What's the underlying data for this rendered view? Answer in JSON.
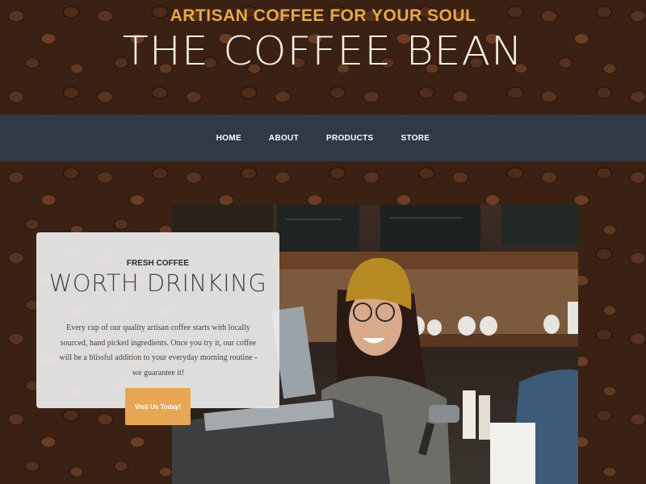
{
  "header": {
    "tagline": "ARTISAN COFFEE FOR YOUR SOUL",
    "title": "THE COFFEE BEAN"
  },
  "nav": {
    "items": [
      "HOME",
      "ABOUT",
      "PRODUCTS",
      "STORE"
    ]
  },
  "intro": {
    "kicker": "FRESH COFFEE",
    "heading": "WORTH DRINKING",
    "text": "Every cup of our quality artisan coffee starts with locally sourced, hand picked ingredients. Once you try it, our coffee will be a blissful addition to your everyday morning routine - we guarantee it!",
    "button_label": "Visit Us Today!"
  },
  "colors": {
    "accent": "#e6a653",
    "nav_bg": "#303946",
    "tagline": "#e8a84a"
  },
  "images": {
    "background": "coffee-beans",
    "photo": "barista-smiling-at-espresso-machine"
  }
}
